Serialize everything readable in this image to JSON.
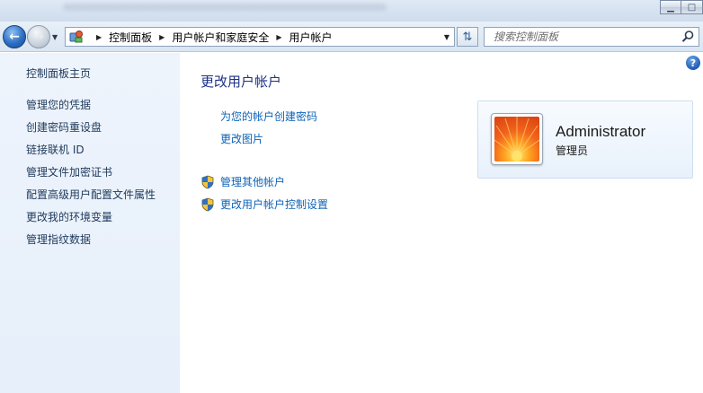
{
  "address_bar": {
    "breadcrumbs": [
      "控制面板",
      "用户帐户和家庭安全",
      "用户帐户"
    ]
  },
  "search": {
    "placeholder": "搜索控制面板"
  },
  "sidebar": {
    "home_label": "控制面板主页",
    "links": [
      "管理您的凭据",
      "创建密码重设盘",
      "链接联机 ID",
      "管理文件加密证书",
      "配置高级用户配置文件属性",
      "更改我的环境变量",
      "管理指纹数据"
    ]
  },
  "main": {
    "title": "更改用户帐户",
    "tasks": [
      "为您的帐户创建密码",
      "更改图片"
    ],
    "shield_tasks": [
      "管理其他帐户",
      "更改用户帐户控制设置"
    ]
  },
  "user": {
    "name": "Administrator",
    "role": "管理员"
  },
  "colors": {
    "link": "#0e63b6",
    "title": "#1e3287",
    "sidebar_bg": "#eef4fc"
  },
  "icons": {
    "back": "back-arrow-icon",
    "forward": "forward-arrow-icon",
    "control_panel": "control-panel-icon",
    "refresh": "refresh-icon",
    "search": "search-icon",
    "help": "help-icon",
    "shield": "uac-shield-icon"
  }
}
